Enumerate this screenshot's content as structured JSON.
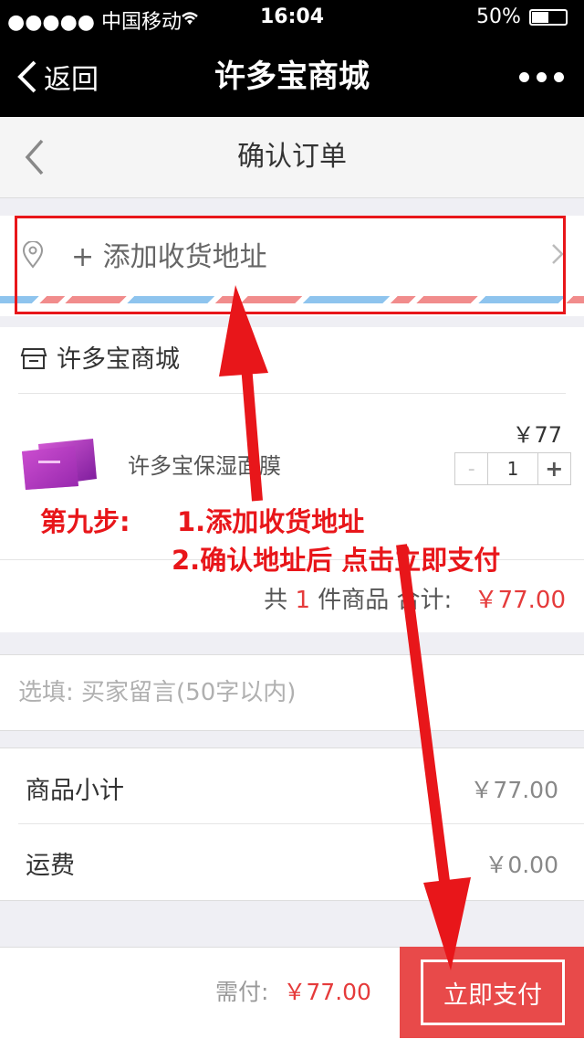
{
  "status_bar": {
    "carrier": "●●●●● 中国移动",
    "time": "16:04",
    "battery": "50%"
  },
  "nav": {
    "back_label": "返回",
    "title": "许多宝商城"
  },
  "page": {
    "title": "确认订单"
  },
  "address": {
    "add_label": "+ 添加收货地址"
  },
  "shop": {
    "name": "许多宝商城",
    "product": {
      "name": "许多宝保湿面膜",
      "price": "￥77",
      "quantity": "1",
      "minus": "-",
      "plus": "+"
    },
    "total": {
      "prefix": "共",
      "count": "1",
      "mid": "件商品  合计:",
      "amount": "￥77.00"
    }
  },
  "note": {
    "placeholder": "选填: 买家留言(50字以内)"
  },
  "summary": {
    "subtotal_label": "商品小计",
    "subtotal_value": "￥77.00",
    "shipping_label": "运费",
    "shipping_value": "￥0.00"
  },
  "footer": {
    "need_pay_label": "需付:",
    "need_pay_amount": "￥77.00",
    "pay_button": "立即支付"
  },
  "annotation": {
    "step": "第九步:",
    "line1": "1.添加收货地址",
    "line2": "2.确认地址后 点击立即支付"
  },
  "colors": {
    "accent_red": "#e53b3b",
    "pay_button": "#e84a4a",
    "annotation_red": "#e8161a"
  }
}
